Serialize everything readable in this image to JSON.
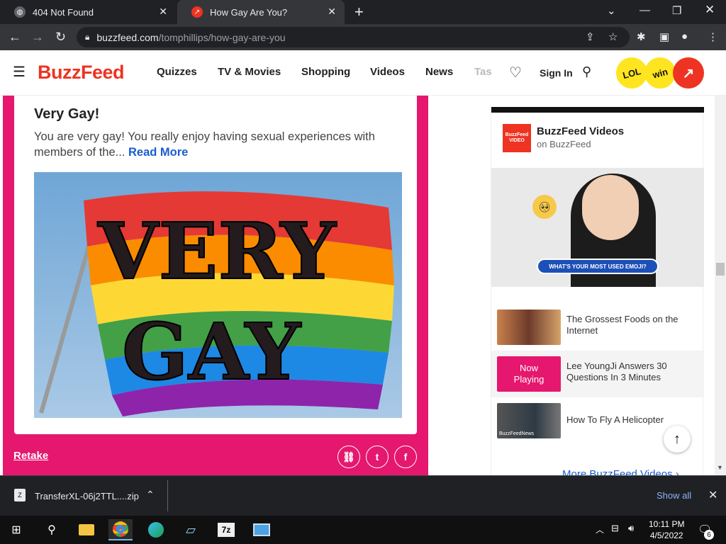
{
  "browser": {
    "tabs": [
      {
        "title": "404 Not Found",
        "active": false
      },
      {
        "title": "How Gay Are You?",
        "active": true
      }
    ],
    "url_host": "buzzfeed.com",
    "url_path": "/tomphillips/how-gay-are-you"
  },
  "site": {
    "logo": "BuzzFeed",
    "nav": [
      "Quizzes",
      "TV & Movies",
      "Shopping",
      "Videos",
      "News",
      "Tas"
    ],
    "sign_in": "Sign In",
    "badges": [
      "LOL",
      "win"
    ]
  },
  "result": {
    "title": "Very Gay!",
    "description": "You are very gay! You really enjoy having sexual experiences with members of the...",
    "read_more": "Read More",
    "image_text_line1": "VERY",
    "image_text_line2": "GAY",
    "retake": "Retake"
  },
  "sidebar": {
    "channel_name": "BuzzFeed Videos",
    "channel_sub": "on BuzzFeed",
    "logo_text": "BuzzFeed VIDEO",
    "video_banner": "WHAT'S YOUR MOST USED EMOJI?",
    "videos": [
      {
        "title": "The Grossest Foods on the Internet",
        "now_playing": false
      },
      {
        "title": "Lee YoungJi Answers 30 Questions In 3 Minutes",
        "now_playing": true,
        "badge": "Now Playing"
      },
      {
        "title": "How To Fly A Helicopter",
        "now_playing": false,
        "thumb_label": "BuzzFeedNews"
      }
    ],
    "more_link": "More BuzzFeed Videos ›"
  },
  "downloads": {
    "file": "TransferXL-06j2TTL....zip",
    "show_all": "Show all"
  },
  "taskbar": {
    "time": "10:11 PM",
    "date": "4/5/2022",
    "notifications": "6",
    "app_7z": "7z"
  },
  "colors": {
    "brand_red": "#e32",
    "pink_card": "#e6176e",
    "link_blue": "#1a5dd0"
  }
}
